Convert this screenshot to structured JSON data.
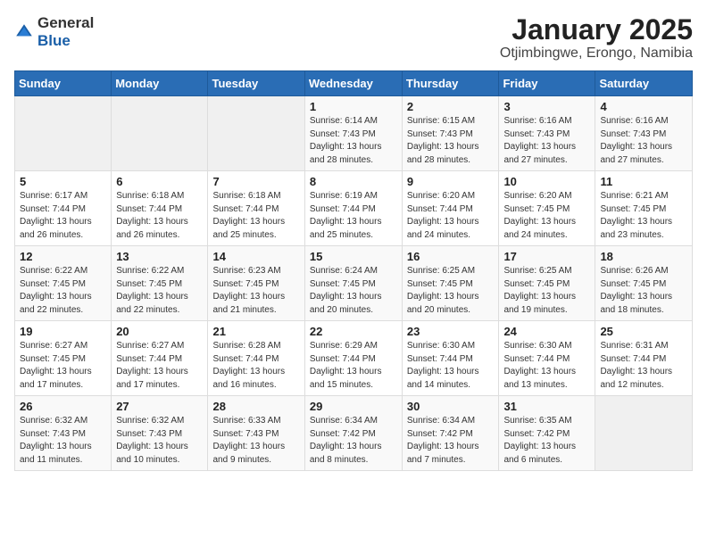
{
  "header": {
    "logo_general": "General",
    "logo_blue": "Blue",
    "title": "January 2025",
    "location": "Otjimbingwe, Erongo, Namibia"
  },
  "weekdays": [
    "Sunday",
    "Monday",
    "Tuesday",
    "Wednesday",
    "Thursday",
    "Friday",
    "Saturday"
  ],
  "weeks": [
    [
      {
        "day": "",
        "sunrise": "",
        "sunset": "",
        "daylight": ""
      },
      {
        "day": "",
        "sunrise": "",
        "sunset": "",
        "daylight": ""
      },
      {
        "day": "",
        "sunrise": "",
        "sunset": "",
        "daylight": ""
      },
      {
        "day": "1",
        "sunrise": "6:14 AM",
        "sunset": "7:43 PM",
        "daylight": "13 hours and 28 minutes."
      },
      {
        "day": "2",
        "sunrise": "6:15 AM",
        "sunset": "7:43 PM",
        "daylight": "13 hours and 28 minutes."
      },
      {
        "day": "3",
        "sunrise": "6:16 AM",
        "sunset": "7:43 PM",
        "daylight": "13 hours and 27 minutes."
      },
      {
        "day": "4",
        "sunrise": "6:16 AM",
        "sunset": "7:43 PM",
        "daylight": "13 hours and 27 minutes."
      }
    ],
    [
      {
        "day": "5",
        "sunrise": "6:17 AM",
        "sunset": "7:44 PM",
        "daylight": "13 hours and 26 minutes."
      },
      {
        "day": "6",
        "sunrise": "6:18 AM",
        "sunset": "7:44 PM",
        "daylight": "13 hours and 26 minutes."
      },
      {
        "day": "7",
        "sunrise": "6:18 AM",
        "sunset": "7:44 PM",
        "daylight": "13 hours and 25 minutes."
      },
      {
        "day": "8",
        "sunrise": "6:19 AM",
        "sunset": "7:44 PM",
        "daylight": "13 hours and 25 minutes."
      },
      {
        "day": "9",
        "sunrise": "6:20 AM",
        "sunset": "7:44 PM",
        "daylight": "13 hours and 24 minutes."
      },
      {
        "day": "10",
        "sunrise": "6:20 AM",
        "sunset": "7:45 PM",
        "daylight": "13 hours and 24 minutes."
      },
      {
        "day": "11",
        "sunrise": "6:21 AM",
        "sunset": "7:45 PM",
        "daylight": "13 hours and 23 minutes."
      }
    ],
    [
      {
        "day": "12",
        "sunrise": "6:22 AM",
        "sunset": "7:45 PM",
        "daylight": "13 hours and 22 minutes."
      },
      {
        "day": "13",
        "sunrise": "6:22 AM",
        "sunset": "7:45 PM",
        "daylight": "13 hours and 22 minutes."
      },
      {
        "day": "14",
        "sunrise": "6:23 AM",
        "sunset": "7:45 PM",
        "daylight": "13 hours and 21 minutes."
      },
      {
        "day": "15",
        "sunrise": "6:24 AM",
        "sunset": "7:45 PM",
        "daylight": "13 hours and 20 minutes."
      },
      {
        "day": "16",
        "sunrise": "6:25 AM",
        "sunset": "7:45 PM",
        "daylight": "13 hours and 20 minutes."
      },
      {
        "day": "17",
        "sunrise": "6:25 AM",
        "sunset": "7:45 PM",
        "daylight": "13 hours and 19 minutes."
      },
      {
        "day": "18",
        "sunrise": "6:26 AM",
        "sunset": "7:45 PM",
        "daylight": "13 hours and 18 minutes."
      }
    ],
    [
      {
        "day": "19",
        "sunrise": "6:27 AM",
        "sunset": "7:45 PM",
        "daylight": "13 hours and 17 minutes."
      },
      {
        "day": "20",
        "sunrise": "6:27 AM",
        "sunset": "7:44 PM",
        "daylight": "13 hours and 17 minutes."
      },
      {
        "day": "21",
        "sunrise": "6:28 AM",
        "sunset": "7:44 PM",
        "daylight": "13 hours and 16 minutes."
      },
      {
        "day": "22",
        "sunrise": "6:29 AM",
        "sunset": "7:44 PM",
        "daylight": "13 hours and 15 minutes."
      },
      {
        "day": "23",
        "sunrise": "6:30 AM",
        "sunset": "7:44 PM",
        "daylight": "13 hours and 14 minutes."
      },
      {
        "day": "24",
        "sunrise": "6:30 AM",
        "sunset": "7:44 PM",
        "daylight": "13 hours and 13 minutes."
      },
      {
        "day": "25",
        "sunrise": "6:31 AM",
        "sunset": "7:44 PM",
        "daylight": "13 hours and 12 minutes."
      }
    ],
    [
      {
        "day": "26",
        "sunrise": "6:32 AM",
        "sunset": "7:43 PM",
        "daylight": "13 hours and 11 minutes."
      },
      {
        "day": "27",
        "sunrise": "6:32 AM",
        "sunset": "7:43 PM",
        "daylight": "13 hours and 10 minutes."
      },
      {
        "day": "28",
        "sunrise": "6:33 AM",
        "sunset": "7:43 PM",
        "daylight": "13 hours and 9 minutes."
      },
      {
        "day": "29",
        "sunrise": "6:34 AM",
        "sunset": "7:42 PM",
        "daylight": "13 hours and 8 minutes."
      },
      {
        "day": "30",
        "sunrise": "6:34 AM",
        "sunset": "7:42 PM",
        "daylight": "13 hours and 7 minutes."
      },
      {
        "day": "31",
        "sunrise": "6:35 AM",
        "sunset": "7:42 PM",
        "daylight": "13 hours and 6 minutes."
      },
      {
        "day": "",
        "sunrise": "",
        "sunset": "",
        "daylight": ""
      }
    ]
  ],
  "labels": {
    "sunrise": "Sunrise:",
    "sunset": "Sunset:",
    "daylight": "Daylight:"
  }
}
